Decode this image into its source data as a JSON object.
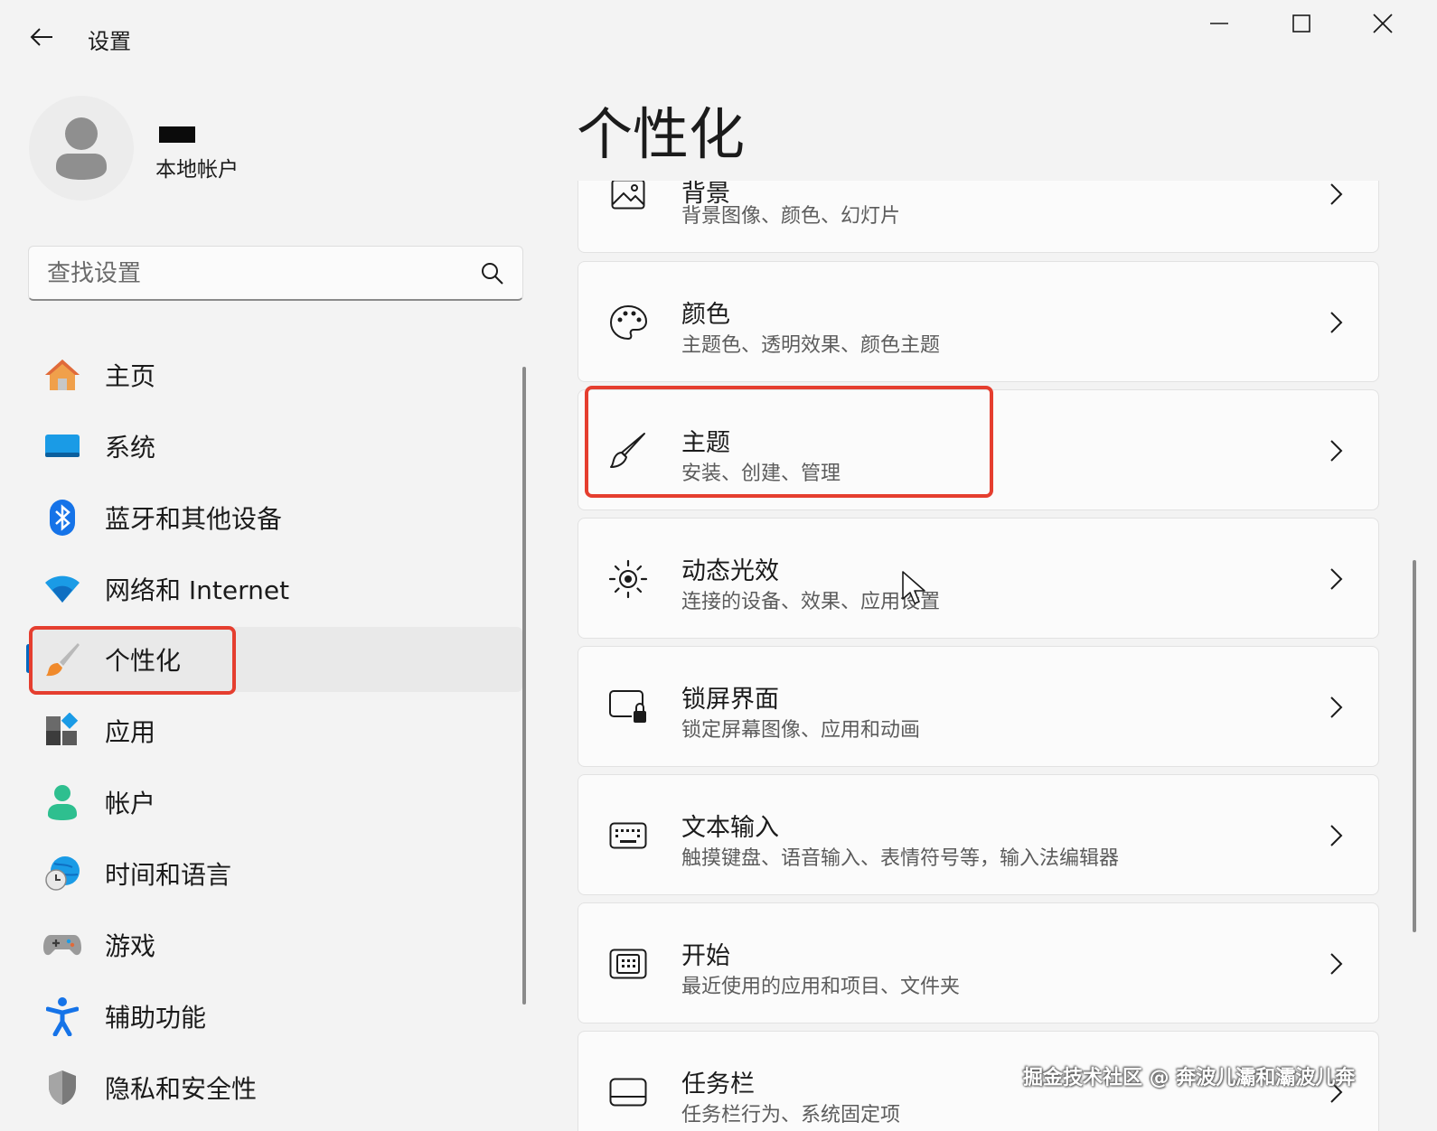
{
  "app": {
    "title": "设置"
  },
  "account": {
    "type": "本地帐户"
  },
  "search": {
    "placeholder": "查找设置"
  },
  "nav": {
    "items": [
      {
        "label": "主页",
        "icon": "home-icon"
      },
      {
        "label": "系统",
        "icon": "system-icon"
      },
      {
        "label": "蓝牙和其他设备",
        "icon": "bluetooth-icon"
      },
      {
        "label": "网络和 Internet",
        "icon": "wifi-icon"
      },
      {
        "label": "个性化",
        "icon": "brush-icon",
        "selected": true
      },
      {
        "label": "应用",
        "icon": "apps-icon"
      },
      {
        "label": "帐户",
        "icon": "account-icon"
      },
      {
        "label": "时间和语言",
        "icon": "globe-clock-icon"
      },
      {
        "label": "游戏",
        "icon": "gamepad-icon"
      },
      {
        "label": "辅助功能",
        "icon": "accessibility-icon"
      },
      {
        "label": "隐私和安全性",
        "icon": "shield-icon"
      }
    ]
  },
  "main": {
    "title": "个性化",
    "cards": [
      {
        "title": "背景",
        "subtitle": "背景图像、颜色、幻灯片",
        "icon": "image-icon"
      },
      {
        "title": "颜色",
        "subtitle": "主题色、透明效果、颜色主题",
        "icon": "palette-icon"
      },
      {
        "title": "主题",
        "subtitle": "安装、创建、管理",
        "icon": "brush-icon"
      },
      {
        "title": "动态光效",
        "subtitle": "连接的设备、效果、应用设置",
        "icon": "dynamic-lighting-icon"
      },
      {
        "title": "锁屏界面",
        "subtitle": "锁定屏幕图像、应用和动画",
        "icon": "lock-screen-icon"
      },
      {
        "title": "文本输入",
        "subtitle": "触摸键盘、语音输入、表情符号等，输入法编辑器",
        "icon": "keyboard-icon"
      },
      {
        "title": "开始",
        "subtitle": "最近使用的应用和项目、文件夹",
        "icon": "start-icon"
      },
      {
        "title": "任务栏",
        "subtitle": "任务栏行为、系统固定项",
        "icon": "taskbar-icon"
      }
    ]
  },
  "watermark": "掘金技术社区 @ 奔波儿灞和灞波儿奔",
  "colors": {
    "highlight": "#e53e2f",
    "accent": "#0067c0",
    "background": "#f3f3f3"
  }
}
